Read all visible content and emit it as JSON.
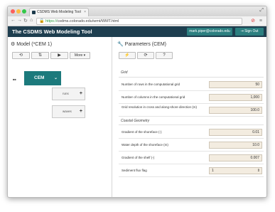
{
  "browser": {
    "tab_title": "CSDMS Web Modeling Tool",
    "tab_close": "×",
    "url_scheme": "https://",
    "url_rest": "csdms.colorado.edu/wmt/WMT.html"
  },
  "app": {
    "title": "The CSDMS Web Modeling Tool",
    "user_label": "mark.piper@colorado.edu",
    "signout_label": "Sign Out"
  },
  "model_panel": {
    "title": "Model (*CEM 1)",
    "buttons": [
      "⟲",
      "⇅",
      "▶",
      "More ▾"
    ],
    "root_block": "CEM",
    "sub_blocks": [
      "runs",
      "waves"
    ],
    "tree_marker": "■■"
  },
  "params_panel": {
    "title": "Parameters (CEM)",
    "buttons": [
      "⚡",
      "⟳",
      "?"
    ],
    "sections": [
      {
        "label": "Grid",
        "params": [
          {
            "label": "Number of rows in the computational grid",
            "value": "50",
            "type": "input"
          },
          {
            "label": "Number of columns in the computational grid",
            "value": "1,000",
            "type": "input"
          },
          {
            "label": "Grid resolution in cross and along-shore direction (m)",
            "value": "100.0",
            "type": "input"
          }
        ]
      },
      {
        "label": "Coastal Geometry",
        "params": [
          {
            "label": "Gradient of the shoreface (-)",
            "value": "0.01",
            "type": "input"
          },
          {
            "label": "Water depth of the shoreface (m)",
            "value": "10.0",
            "type": "input"
          },
          {
            "label": "Gradient of the shelf (-)",
            "value": "0.007",
            "type": "input"
          },
          {
            "label": "Sediment flux flag",
            "value": "1",
            "type": "select"
          }
        ]
      }
    ]
  }
}
